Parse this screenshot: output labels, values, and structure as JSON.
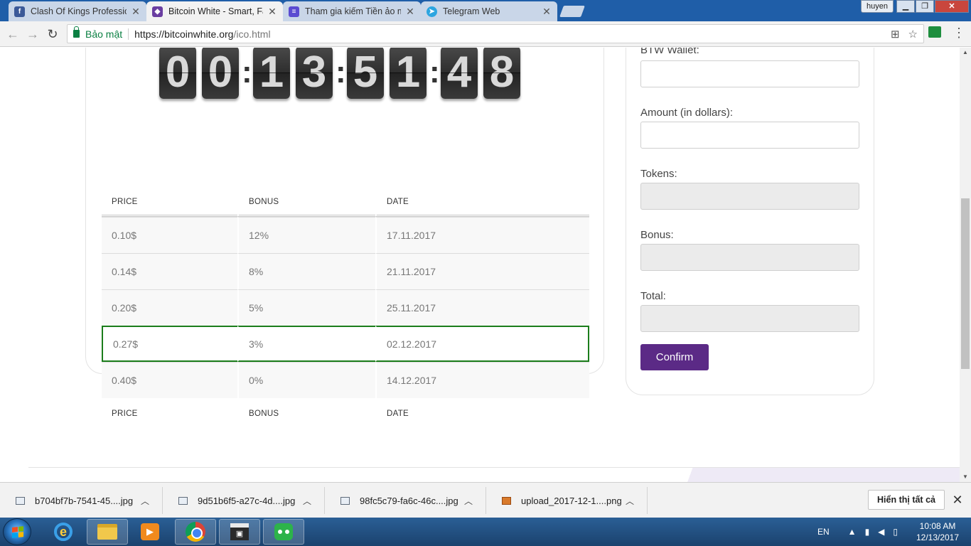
{
  "browser": {
    "tabs": [
      {
        "title": "Clash Of Kings Profession",
        "icon": "facebook-icon",
        "color": "#3b5998"
      },
      {
        "title": "Bitcoin White - Smart, Fa",
        "icon": "bitcoin-white-icon",
        "color": "#6a3ea1",
        "active": true
      },
      {
        "title": "Tham gia kiếm Tiền ảo m",
        "icon": "list-icon",
        "color": "#5a4bd1"
      },
      {
        "title": "Telegram Web",
        "icon": "telegram-icon",
        "color": "#2ca5e0"
      }
    ],
    "profile_name": "huyen",
    "security_label": "Bảo mật",
    "url_host": "https://bitcoinwhite.org",
    "url_path": "/ico.html"
  },
  "countdown": {
    "digits": [
      "0",
      "0",
      "1",
      "3",
      "5",
      "1",
      "4",
      "8"
    ]
  },
  "ico_table": {
    "headers": [
      "PRICE",
      "BONUS",
      "DATE"
    ],
    "rows": [
      {
        "price": "0.10$",
        "bonus": "12%",
        "date": "17.11.2017"
      },
      {
        "price": "0.14$",
        "bonus": "8%",
        "date": "21.11.2017"
      },
      {
        "price": "0.20$",
        "bonus": "5%",
        "date": "25.11.2017"
      },
      {
        "price": "0.27$",
        "bonus": "3%",
        "date": "02.12.2017"
      },
      {
        "price": "0.40$",
        "bonus": "0%",
        "date": "14.12.2017"
      }
    ],
    "highlight_color": "#1b7d1b"
  },
  "form": {
    "wallet_label": "BTW Wallet:",
    "amount_label": "Amount (in dollars):",
    "tokens_label": "Tokens:",
    "bonus_label": "Bonus:",
    "total_label": "Total:",
    "confirm_label": "Confirm",
    "accent_color": "#5b2a86"
  },
  "downloads": {
    "items": [
      {
        "name": "b704bf7b-7541-45....jpg",
        "type": "jpg"
      },
      {
        "name": "9d51b6f5-a27c-4d....jpg",
        "type": "jpg"
      },
      {
        "name": "98fc5c79-fa6c-46c....jpg",
        "type": "jpg"
      },
      {
        "name": "upload_2017-12-1....png",
        "type": "png"
      }
    ],
    "show_all_label": "Hiển thị tất cả"
  },
  "taskbar": {
    "language": "EN",
    "time": "10:08 AM",
    "date": "12/13/2017"
  }
}
